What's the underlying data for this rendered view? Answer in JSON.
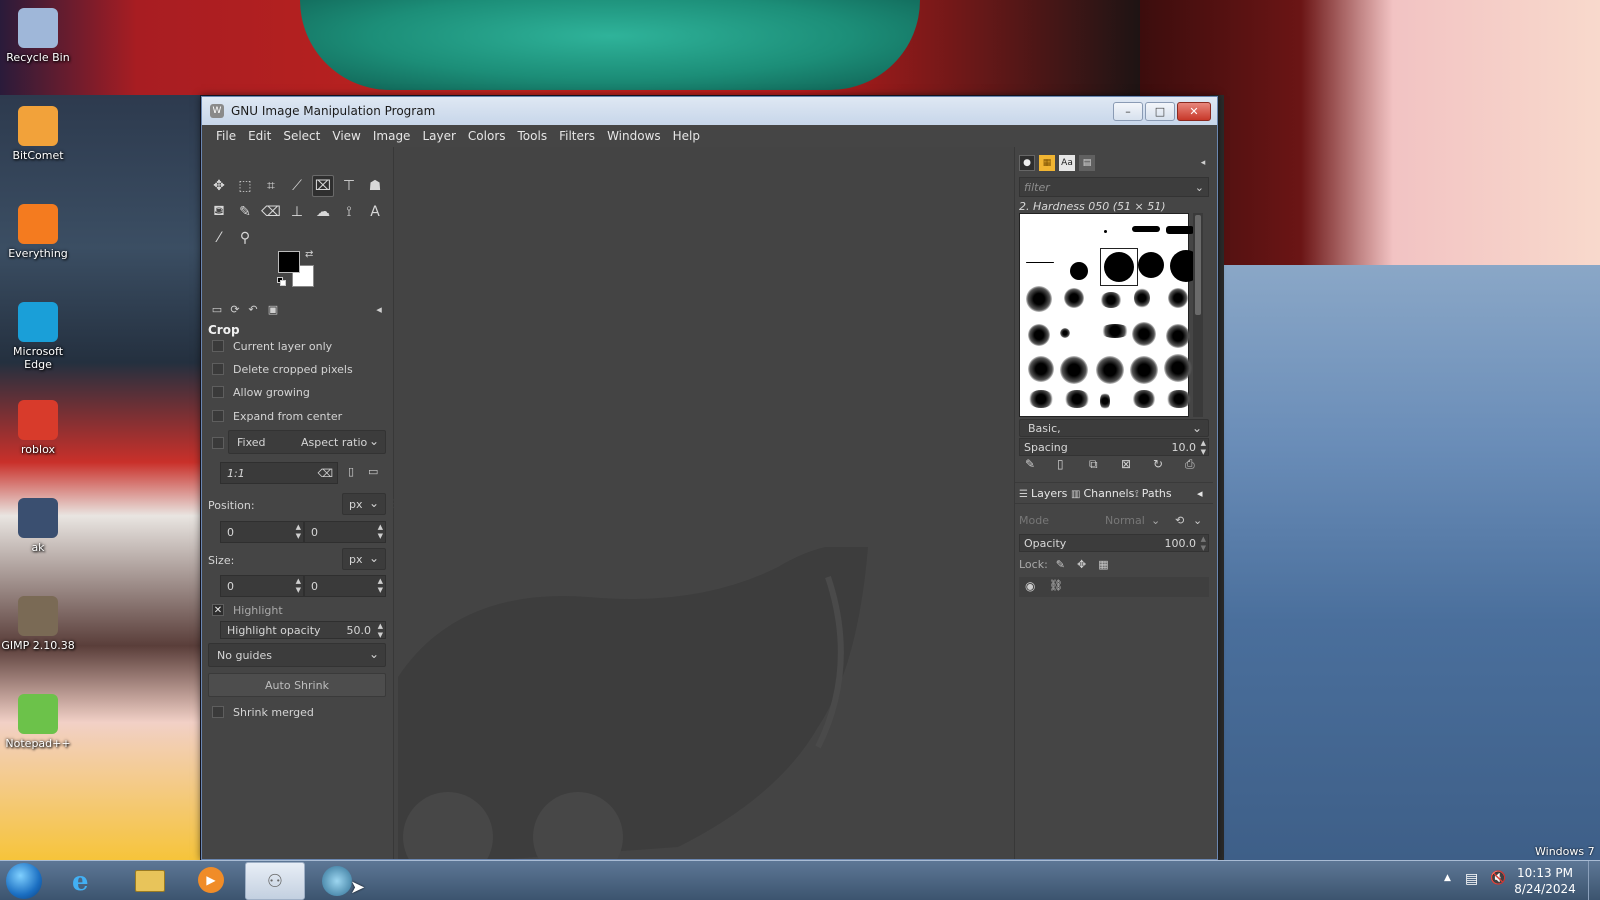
{
  "window": {
    "title": "GNU Image Manipulation Program",
    "minimize": "–",
    "maximize": "□",
    "close": "✕"
  },
  "menubar": [
    "File",
    "Edit",
    "Select",
    "View",
    "Image",
    "Layer",
    "Colors",
    "Tools",
    "Filters",
    "Windows",
    "Help"
  ],
  "toolbox": {
    "tools": [
      {
        "name": "move-tool-icon",
        "glyph": "✥"
      },
      {
        "name": "rect-select-tool-icon",
        "glyph": "⬚"
      },
      {
        "name": "free-select-tool-icon",
        "glyph": "⌗"
      },
      {
        "name": "fuzzy-select-tool-icon",
        "glyph": "⟋"
      },
      {
        "name": "crop-tool-icon",
        "glyph": "⌧"
      },
      {
        "name": "unified-transform-tool-icon",
        "glyph": "⊤"
      },
      {
        "name": "warp-transform-tool-icon",
        "glyph": "☗"
      },
      {
        "name": "bucket-fill-tool-icon",
        "glyph": "⛾"
      },
      {
        "name": "paintbrush-tool-icon",
        "glyph": "✎"
      },
      {
        "name": "eraser-tool-icon",
        "glyph": "⌫"
      },
      {
        "name": "clone-tool-icon",
        "glyph": "⊥"
      },
      {
        "name": "smudge-tool-icon",
        "glyph": "☁"
      },
      {
        "name": "paths-tool-icon",
        "glyph": "⟟"
      },
      {
        "name": "text-tool-icon",
        "glyph": "A"
      },
      {
        "name": "color-picker-tool-icon",
        "glyph": "⁄"
      },
      {
        "name": "zoom-tool-icon",
        "glyph": "⚲"
      }
    ]
  },
  "tool_options": {
    "title": "Crop",
    "current_layer_only": "Current layer only",
    "delete_cropped_pixels": "Delete cropped pixels",
    "allow_growing": "Allow growing",
    "expand_from_center": "Expand from center",
    "fixed": "Fixed",
    "fixed_mode": "Aspect ratio",
    "ratio_value": "1:1",
    "position_label": "Position:",
    "position_unit": "px",
    "position_x": "0",
    "position_y": "0",
    "size_label": "Size:",
    "size_unit": "px",
    "size_w": "0",
    "size_h": "0",
    "highlight": "Highlight",
    "highlight_opacity_label": "Highlight opacity",
    "highlight_opacity_value": "50.0",
    "guides": "No guides",
    "auto_shrink": "Auto Shrink",
    "shrink_merged": "Shrink merged"
  },
  "brushes": {
    "filter_placeholder": "filter",
    "selected_brush": "2. Hardness 050 (51 × 51)",
    "preset": "Basic,",
    "spacing_label": "Spacing",
    "spacing_value": "10.0"
  },
  "layers": {
    "tab_layers": "Layers",
    "tab_channels": "Channels",
    "tab_paths": "Paths",
    "mode_label": "Mode",
    "mode_value": "Normal",
    "opacity_label": "Opacity",
    "opacity_value": "100.0",
    "lock_label": "Lock:"
  },
  "desktop_icons": [
    {
      "label": "Recycle Bin",
      "color": "#9fb7d9"
    },
    {
      "label": "BitComet",
      "color": "#f2a23a"
    },
    {
      "label": "Everything",
      "color": "#f47b1f"
    },
    {
      "label": "Microsoft Edge",
      "color": "#1a9fd8"
    },
    {
      "label": "roblox",
      "color": "#d83b2b"
    },
    {
      "label": "ak",
      "color": "#3a4f70"
    },
    {
      "label": "GIMP 2.10.38",
      "color": "#7a6a55"
    },
    {
      "label": "Notepad++",
      "color": "#6cc24a"
    }
  ],
  "taskbar": {
    "time": "10:13 PM",
    "date": "8/24/2024",
    "watermark": "Windows 7"
  }
}
